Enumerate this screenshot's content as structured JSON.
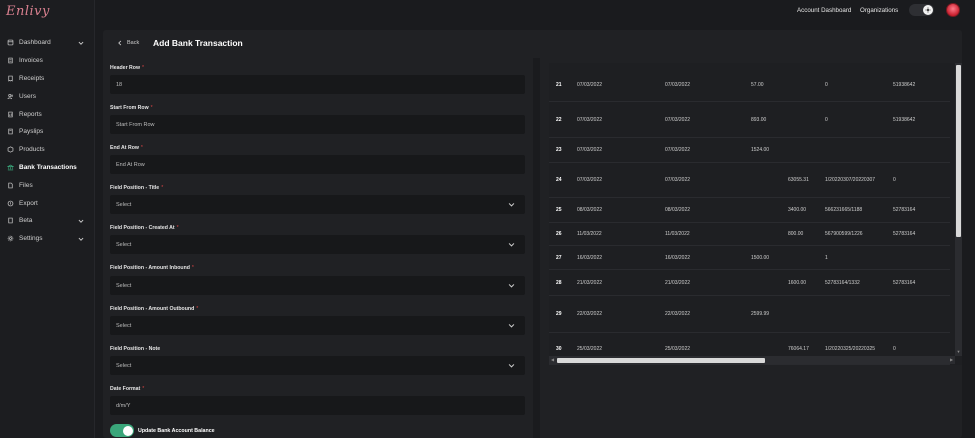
{
  "app": {
    "logo": "Enlivy"
  },
  "topbar": {
    "account_dashboard": "Account Dashboard",
    "organizations": "Organizations"
  },
  "sidebar": {
    "items": [
      {
        "label": "Dashboard",
        "icon": "dashboard-icon",
        "has_chevron": true
      },
      {
        "label": "Invoices",
        "icon": "invoice-icon",
        "has_chevron": false
      },
      {
        "label": "Receipts",
        "icon": "receipt-icon",
        "has_chevron": false
      },
      {
        "label": "Users",
        "icon": "users-icon",
        "has_chevron": false
      },
      {
        "label": "Reports",
        "icon": "reports-icon",
        "has_chevron": false
      },
      {
        "label": "Payslips",
        "icon": "payslip-icon",
        "has_chevron": false
      },
      {
        "label": "Products",
        "icon": "products-icon",
        "has_chevron": false
      },
      {
        "label": "Bank Transactions",
        "icon": "bank-icon",
        "has_chevron": false,
        "active": true
      },
      {
        "label": "Files",
        "icon": "files-icon",
        "has_chevron": false
      },
      {
        "label": "Export",
        "icon": "export-icon",
        "has_chevron": false
      },
      {
        "label": "Beta",
        "icon": "beta-icon",
        "has_chevron": true
      },
      {
        "label": "Settings",
        "icon": "gear-icon",
        "has_chevron": true
      }
    ]
  },
  "page": {
    "back": "Back",
    "title": "Add Bank Transaction"
  },
  "form": {
    "header_row": {
      "label": "Header Row",
      "value": "18"
    },
    "start_from_row": {
      "label": "Start From Row",
      "placeholder": "Start From Row"
    },
    "end_at_row": {
      "label": "End At Row",
      "placeholder": "End At Row"
    },
    "title_pos": {
      "label": "Field Position - Title",
      "value": "Select"
    },
    "created_at_pos": {
      "label": "Field Position - Created At",
      "value": "Select"
    },
    "amount_inbound_pos": {
      "label": "Field Position - Amount Inbound",
      "value": "Select"
    },
    "amount_outbound_pos": {
      "label": "Field Position - Amount Outbound",
      "value": "Select"
    },
    "note_pos": {
      "label": "Field Position - Note",
      "value": "Select"
    },
    "date_format": {
      "label": "Date Format",
      "value": "d/m/Y"
    },
    "update_balance": {
      "label": "Update Bank Account Balance",
      "checked": true
    },
    "required_mark": "*"
  },
  "table": {
    "rows": [
      {
        "idx": "21",
        "c1": "07/03/2022",
        "c2": "07/03/2022",
        "c3": "57.00",
        "c4": "",
        "c5": "0",
        "c6": "51938642"
      },
      {
        "idx": "22",
        "c1": "07/03/2022",
        "c2": "07/03/2022",
        "c3": "893.00",
        "c4": "",
        "c5": "0",
        "c6": "51938642"
      },
      {
        "idx": "23",
        "c1": "07/03/2022",
        "c2": "07/03/2022",
        "c3": "1524.00",
        "c4": "",
        "c5": "",
        "c6": ""
      },
      {
        "idx": "24",
        "c1": "07/03/2022",
        "c2": "07/03/2022",
        "c3": "",
        "c4": "63055.31",
        "c5": "1/20220307/20220307",
        "c6": "0"
      },
      {
        "idx": "25",
        "c1": "08/03/2022",
        "c2": "08/03/2022",
        "c3": "",
        "c4": "3400.00",
        "c5": "566231665/1188",
        "c6": "52783164"
      },
      {
        "idx": "26",
        "c1": "11/03/2022",
        "c2": "11/03/2022",
        "c3": "",
        "c4": "800.00",
        "c5": "567900599/1226",
        "c6": "52783164"
      },
      {
        "idx": "27",
        "c1": "16/03/2022",
        "c2": "16/03/2022",
        "c3": "1500.00",
        "c4": "",
        "c5": "1",
        "c6": ""
      },
      {
        "idx": "28",
        "c1": "21/03/2022",
        "c2": "21/03/2022",
        "c3": "",
        "c4": "1600.00",
        "c5": "52783164/1332",
        "c6": "52783164"
      },
      {
        "idx": "29",
        "c1": "22/03/2022",
        "c2": "22/03/2022",
        "c3": "2599.99",
        "c4": "",
        "c5": "",
        "c6": ""
      },
      {
        "idx": "30",
        "c1": "25/03/2022",
        "c2": "25/03/2022",
        "c3": "",
        "c4": "76064.17",
        "c5": "1/20220325/20220325",
        "c6": "0"
      }
    ]
  },
  "colors": {
    "accent_toggle": "#3aa67a",
    "required": "#dd4444",
    "logo": "#d9808f"
  }
}
